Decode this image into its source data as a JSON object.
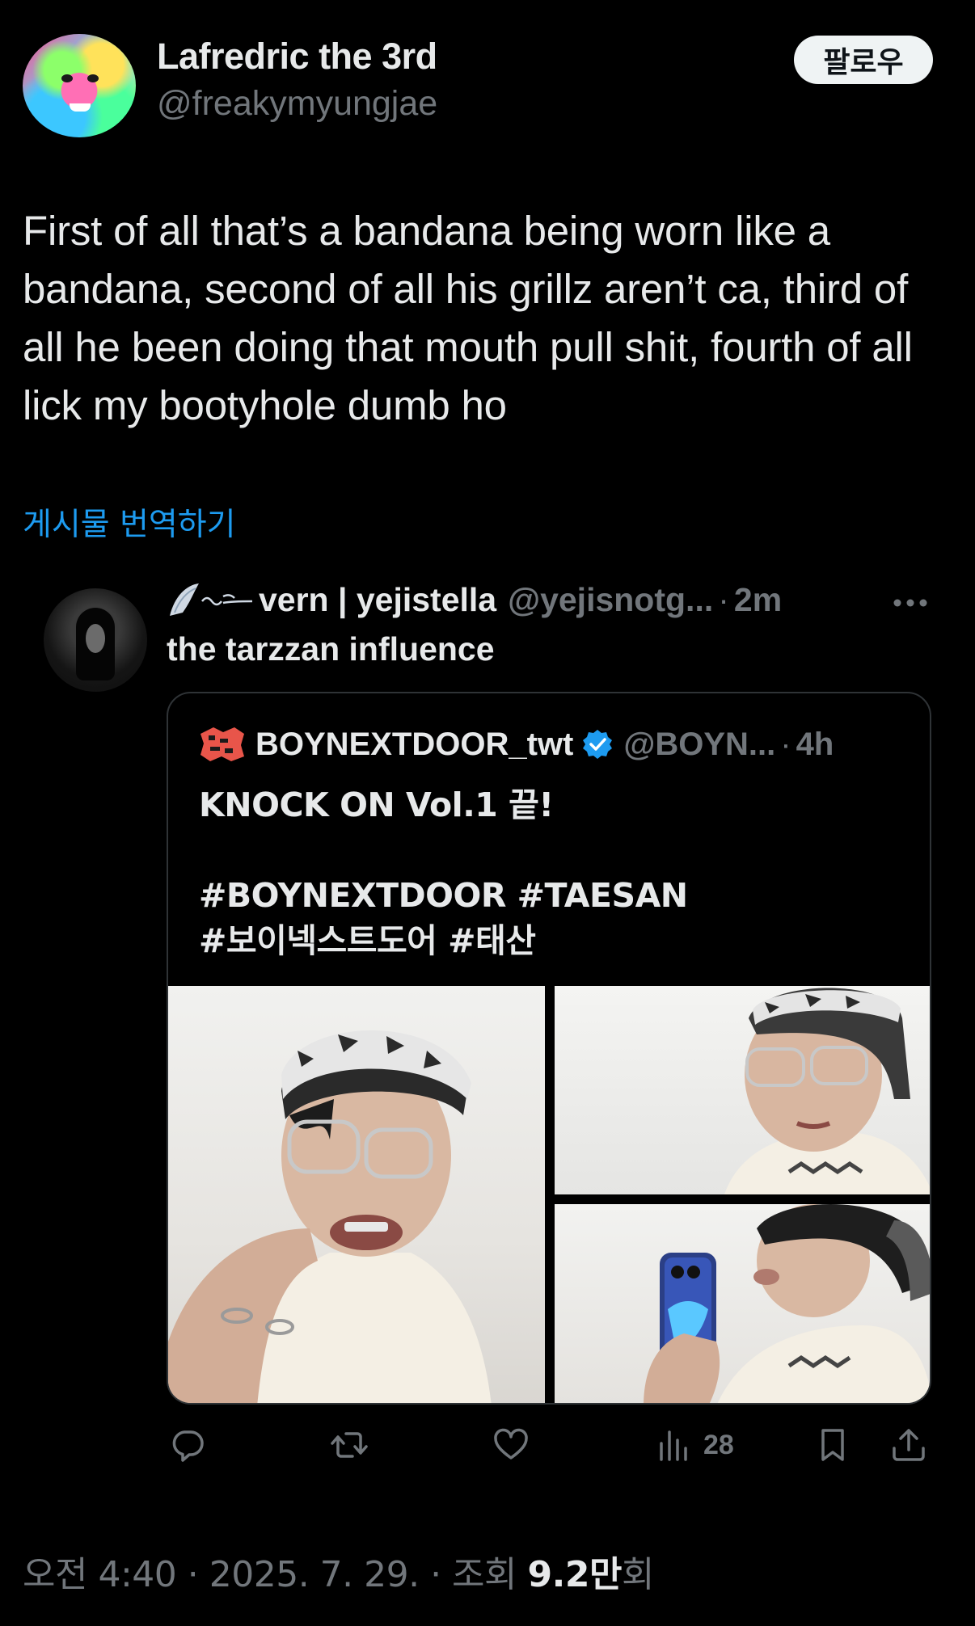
{
  "post": {
    "display_name": "Lafredric the 3rd",
    "handle": "@freakymyungjae",
    "follow_label": "팔로우",
    "text": "First of all that’s a bandana being worn like a bandana, second of all his grillz aren’t ca, third of all he been doing that mouth pull shit, fourth of all lick my bootyhole dumb ho",
    "translate_label": "게시물 번역하기"
  },
  "quote": {
    "name": "vern | yejistella",
    "handle": "@yejisnotg...",
    "separator": "·",
    "time": "2m",
    "text": "the tarzzan influence",
    "nested": {
      "name": "BOYNEXTDOOR_twt",
      "handle": "@BOYN...",
      "separator": "·",
      "time": "4h",
      "text": "KNOCK ON Vol.1 끝!\n\n#BOYNEXTDOOR #TAESAN\n#보이넥스트도어 #태산"
    }
  },
  "actions": {
    "views": "28"
  },
  "footer": {
    "meta_prefix": "오전 4:40 · 2025. 7. 29. · 조회 ",
    "views_number": "9.2만",
    "views_suffix": "회"
  },
  "colors": {
    "background": "#000000",
    "text": "#e7e9ea",
    "secondary": "#71767b",
    "link": "#1d9bf0",
    "border": "#2f3336",
    "verified": "#1d9bf0"
  },
  "icons": [
    "more-icon",
    "verified-icon",
    "reply-icon",
    "repost-icon",
    "like-icon",
    "views-icon",
    "bookmark-icon",
    "share-icon"
  ]
}
